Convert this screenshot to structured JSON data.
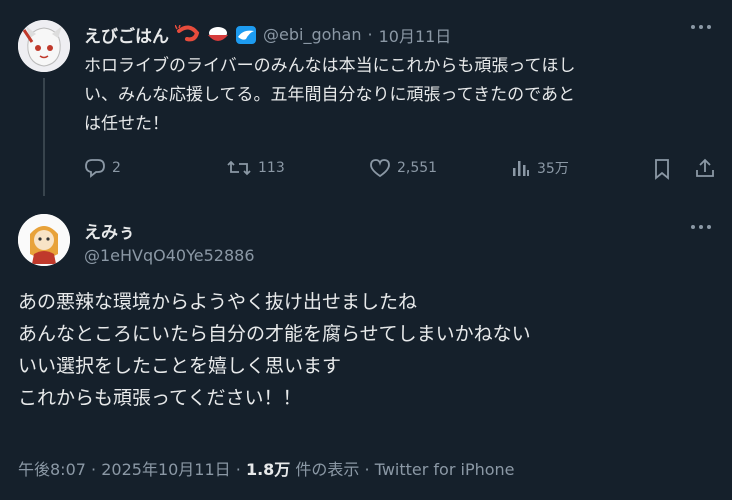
{
  "parent_tweet": {
    "display_name": "えびごはん",
    "handle": "@ebi_gohan",
    "separator": "·",
    "date": "10月11日",
    "text_lines": [
      "ホロライブのライバーのみんなは本当にこれからも頑張ってほし",
      "い、みんな応援してる。五年間自分なりに頑張ってきたのであと",
      "は任せた！"
    ],
    "actions": {
      "replies": "2",
      "retweets": "113",
      "likes": "2,551",
      "views": "35万"
    },
    "colors": {
      "verified_badge": "#1d9bf0"
    }
  },
  "main_tweet": {
    "display_name": "えみぅ",
    "handle": "@1eHVqO40Ye52886",
    "text_lines": [
      "あの悪辣な環境からようやく抜け出せましたね",
      "あんなところにいたら自分の才能を腐らせてしまいかねない",
      "いい選択をしたことを嬉しく思います",
      "これからも頑張ってください！！"
    ],
    "meta": {
      "time": "午後8:07",
      "sep1": "·",
      "date": "2025年10月11日",
      "sep2": "·",
      "views_count": "1.8万",
      "views_label": "件の表示",
      "sep3": "·",
      "client": "Twitter for iPhone"
    }
  },
  "icons": {
    "more": "more-horizontal-icon",
    "reply": "reply-icon",
    "retweet": "retweet-icon",
    "like": "heart-icon",
    "views": "views-chart-icon",
    "bookmark": "bookmark-icon",
    "share": "share-icon"
  }
}
